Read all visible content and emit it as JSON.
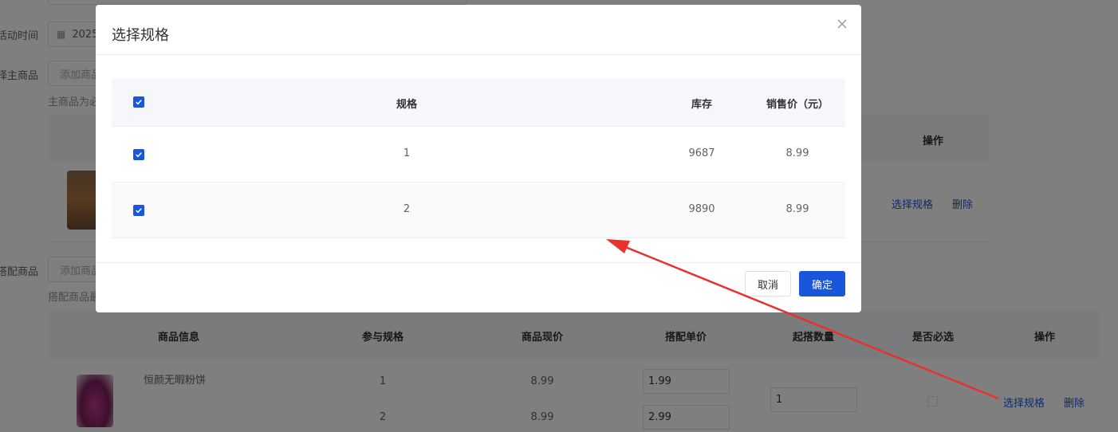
{
  "background": {
    "form": {
      "activity_time_label": "活动时间:",
      "activity_time_value": "2025",
      "main_product_label": "选择主商品:",
      "main_product_placeholder": "添加商品",
      "main_product_hint": "主商品为必",
      "combo_product_label": "选择搭配商品:",
      "combo_product_placeholder": "添加商品",
      "combo_product_hint": "搭配商品最"
    },
    "main_table": {
      "operation_header": "操作",
      "row_links": {
        "select_spec": "选择规格",
        "delete": "删除"
      }
    },
    "combo_table": {
      "headers": [
        "商品信息",
        "参与规格",
        "商品现价",
        "搭配单价",
        "起搭数量",
        "是否必选",
        "操作"
      ],
      "product_name": "恒颜无暇粉饼",
      "specs": [
        "1",
        "2"
      ],
      "current_prices": [
        "8.99",
        "8.99"
      ],
      "combo_prices": [
        "1.99",
        "2.99"
      ],
      "start_quantity": "1",
      "required": false,
      "row_links": {
        "select_spec": "选择规格",
        "delete": "删除"
      }
    }
  },
  "dialog": {
    "title": "选择规格",
    "table": {
      "headers": {
        "spec": "规格",
        "stock": "库存",
        "price": "销售价（元）"
      },
      "all_selected": true,
      "rows": [
        {
          "selected": true,
          "spec": "1",
          "stock": "9687",
          "price": "8.99"
        },
        {
          "selected": true,
          "spec": "2",
          "stock": "9890",
          "price": "8.99"
        }
      ]
    },
    "buttons": {
      "cancel": "取消",
      "confirm": "确定"
    }
  },
  "colors": {
    "primary": "#1a56db",
    "annotation_arrow": "#e8322d"
  }
}
